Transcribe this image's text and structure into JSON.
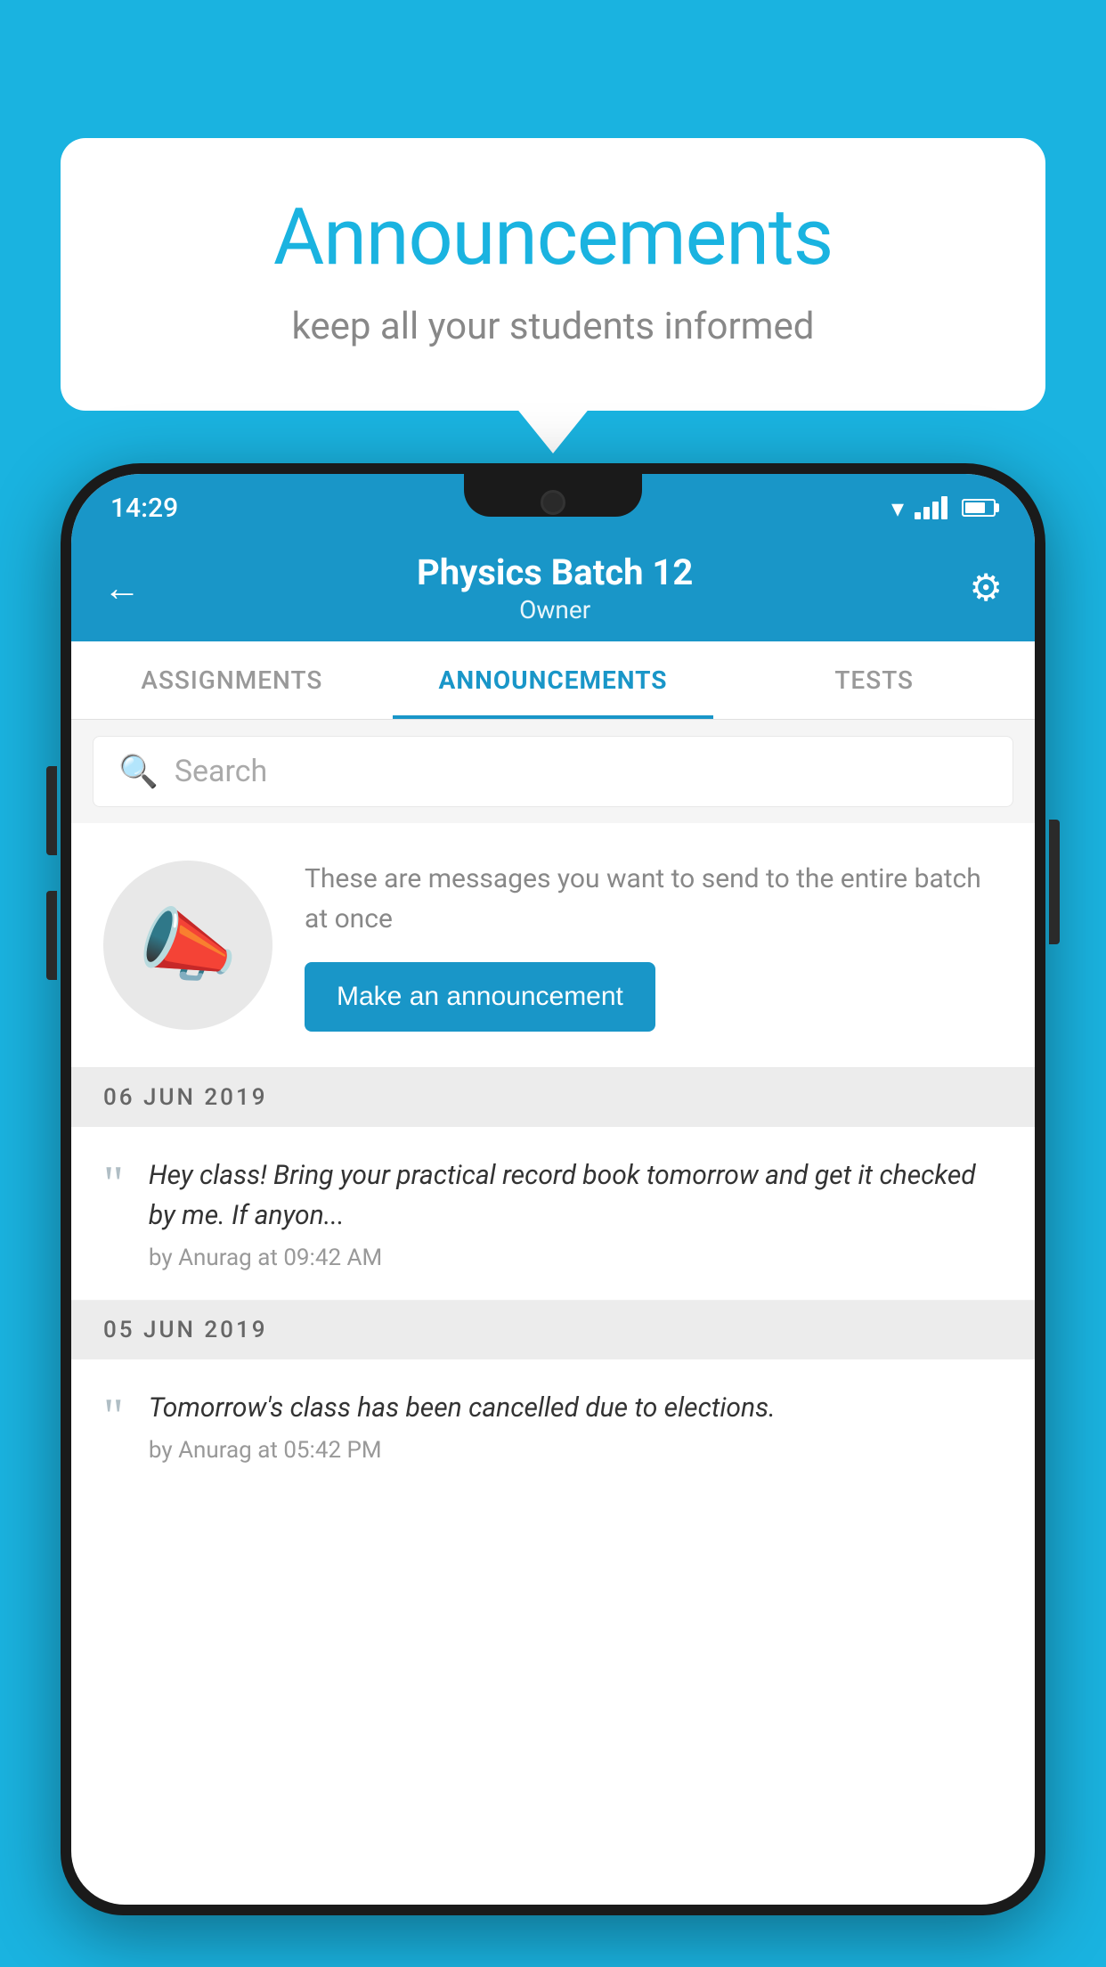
{
  "bubble": {
    "title": "Announcements",
    "subtitle": "keep all your students informed"
  },
  "phone": {
    "statusBar": {
      "time": "14:29"
    },
    "header": {
      "title": "Physics Batch 12",
      "subtitle": "Owner"
    },
    "tabs": [
      {
        "label": "ASSIGNMENTS",
        "active": false
      },
      {
        "label": "ANNOUNCEMENTS",
        "active": true
      },
      {
        "label": "TESTS",
        "active": false
      }
    ],
    "search": {
      "placeholder": "Search"
    },
    "announcementPrompt": {
      "description": "These are messages you want to send to the entire batch at once",
      "buttonLabel": "Make an announcement"
    },
    "dates": [
      {
        "label": "06  JUN  2019",
        "announcements": [
          {
            "message": "Hey class! Bring your practical record book tomorrow and get it checked by me. If anyon...",
            "author": "by Anurag at 09:42 AM"
          }
        ]
      },
      {
        "label": "05  JUN  2019",
        "announcements": [
          {
            "message": "Tomorrow's class has been cancelled due to elections.",
            "author": "by Anurag at 05:42 PM"
          }
        ]
      }
    ]
  },
  "colors": {
    "accent": "#1996c8",
    "background": "#1ab3e0"
  }
}
